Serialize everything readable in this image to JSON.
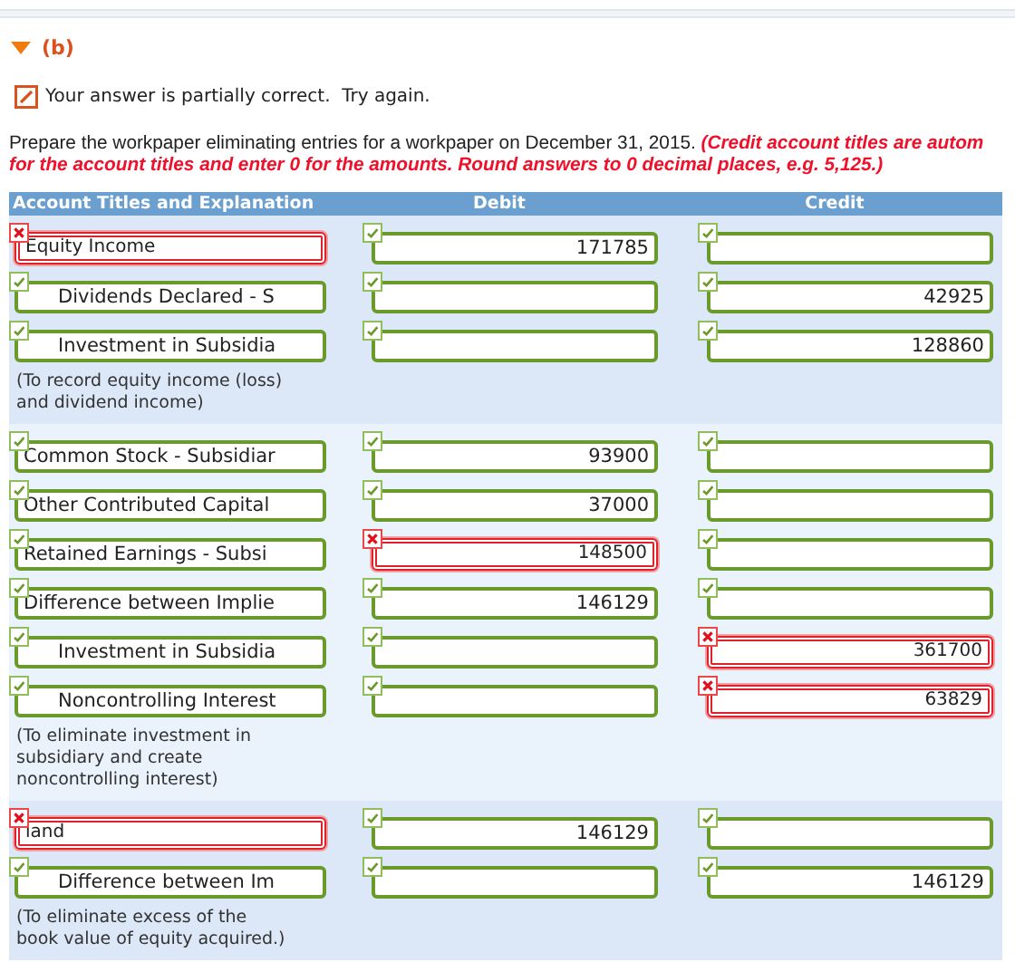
{
  "part": {
    "label": "(b)",
    "expanded": true
  },
  "feedback": {
    "text": "Your answer is partially correct.  Try again."
  },
  "instructions": [
    "Prepare the workpaper eliminating entries for a workpaper on December 31, 2015. **(Credit account titles are autom**",
    "**for the account titles and enter 0 for the amounts. Round answers to 0 decimal places, e.g. 5,125.)**"
  ],
  "table": {
    "columns": [
      "Account Titles and Explanation",
      "Debit",
      "Credit"
    ],
    "entries": [
      {
        "lines": [
          {
            "indented": false,
            "account": {
              "value": "Equity Income",
              "correct": false
            },
            "debit": {
              "value": "171785",
              "correct": true
            },
            "credit": {
              "correct": true
            }
          },
          {
            "indented": true,
            "account": {
              "value": "Dividends Declared - S",
              "correct": true
            },
            "debit": {
              "correct": true
            },
            "credit": {
              "value": "42925",
              "correct": true
            }
          },
          {
            "indented": true,
            "account": {
              "value": "Investment in Subsidia",
              "correct": true
            },
            "debit": {
              "correct": true
            },
            "credit": {
              "value": "128860",
              "correct": true
            }
          }
        ],
        "note": "(To record equity income (loss) and dividend income)"
      },
      {
        "lines": [
          {
            "indented": false,
            "account": {
              "value": "Common Stock - Subsidiar",
              "correct": true
            },
            "debit": {
              "value": "93900",
              "correct": true
            },
            "credit": {
              "correct": true
            }
          },
          {
            "indented": false,
            "account": {
              "value": "Other Contributed Capital",
              "correct": true
            },
            "debit": {
              "value": "37000",
              "correct": true
            },
            "credit": {
              "correct": true
            }
          },
          {
            "indented": false,
            "account": {
              "value": "Retained Earnings - Subsi",
              "correct": true
            },
            "debit": {
              "value": "148500",
              "correct": false
            },
            "credit": {
              "correct": true
            }
          },
          {
            "indented": false,
            "account": {
              "value": "Difference between Implie",
              "correct": true
            },
            "debit": {
              "value": "146129",
              "correct": true
            },
            "credit": {
              "correct": true
            }
          },
          {
            "indented": true,
            "account": {
              "value": "Investment in Subsidia",
              "correct": true
            },
            "debit": {
              "correct": true
            },
            "credit": {
              "value": "361700",
              "correct": false
            }
          },
          {
            "indented": true,
            "account": {
              "value": "Noncontrolling Interest",
              "correct": true
            },
            "debit": {
              "correct": true
            },
            "credit": {
              "value": "63829",
              "correct": false
            }
          }
        ],
        "note": "(To eliminate investment in subsidiary and create noncontrolling interest)"
      },
      {
        "lines": [
          {
            "indented": false,
            "account": {
              "value": "land",
              "correct": false
            },
            "debit": {
              "value": "146129",
              "correct": true
            },
            "credit": {
              "correct": true
            }
          },
          {
            "indented": true,
            "account": {
              "value": "Difference between Im",
              "correct": true
            },
            "debit": {
              "correct": true
            },
            "credit": {
              "value": "146129",
              "correct": true
            }
          }
        ],
        "note": "(To eliminate excess of the book value of equity acquired.)"
      }
    ]
  }
}
